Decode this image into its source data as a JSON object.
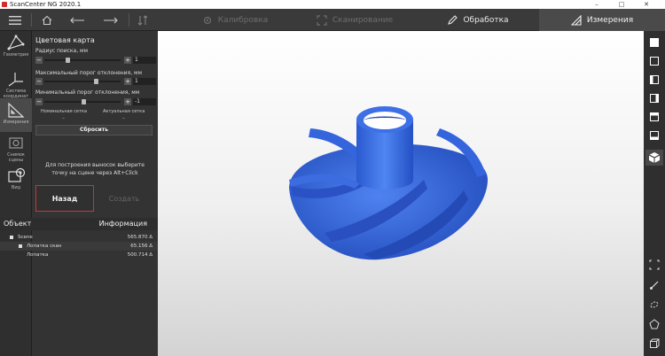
{
  "window": {
    "title": "ScanCenter NG 2020.1",
    "minimize": "–",
    "maximize": "□",
    "close": "✕"
  },
  "toolbar": {
    "tabs": [
      {
        "label": "Калибровка",
        "state": "disabled"
      },
      {
        "label": "Сканирование",
        "state": "disabled"
      },
      {
        "label": "Обработка",
        "state": "enabled"
      },
      {
        "label": "Измерения",
        "state": "selected"
      }
    ]
  },
  "left_strip": {
    "items": [
      {
        "label": "Геометрия",
        "icon": "geometry-icon"
      },
      {
        "label": "Система координат",
        "icon": "coordinate-system-icon"
      },
      {
        "label": "Измерения",
        "icon": "measurement-ruler-icon",
        "selected": true
      },
      {
        "label": "Снимок сцены",
        "icon": "camera-icon"
      },
      {
        "label": "Вид",
        "icon": "view-icon"
      }
    ]
  },
  "panel": {
    "title": "Цветовая карта",
    "search_radius": {
      "label": "Радиус поиска, мм",
      "value": "1",
      "minus": "−",
      "plus": "+"
    },
    "max_threshold": {
      "label": "Максимальный порог отклонения, мм",
      "value": "1",
      "minus": "−",
      "plus": "+"
    },
    "min_threshold": {
      "label": "Минимальный порог отклонения, мм",
      "value": "-1",
      "minus": "−",
      "plus": "+"
    },
    "nominal_grid": "Номинальная сетка",
    "actual_grid": "Актуальная сетка",
    "nominal_value": "–",
    "actual_value": "–",
    "reset": "Сбросить",
    "hint": "Для построения выносок выберите точку на сцене через Alt+Click",
    "back": "Назад",
    "create": "Создать"
  },
  "objects": {
    "col_object": "Объект",
    "col_info": "Информация",
    "rows": [
      {
        "name": "Scene",
        "info": "565.870 Δ"
      },
      {
        "name": "Лопатка скан",
        "info": "65.156 Δ"
      },
      {
        "name": "Лопатка",
        "info": "500.714 Δ"
      }
    ]
  },
  "viewport": {
    "model_color": "#2f63d8"
  }
}
